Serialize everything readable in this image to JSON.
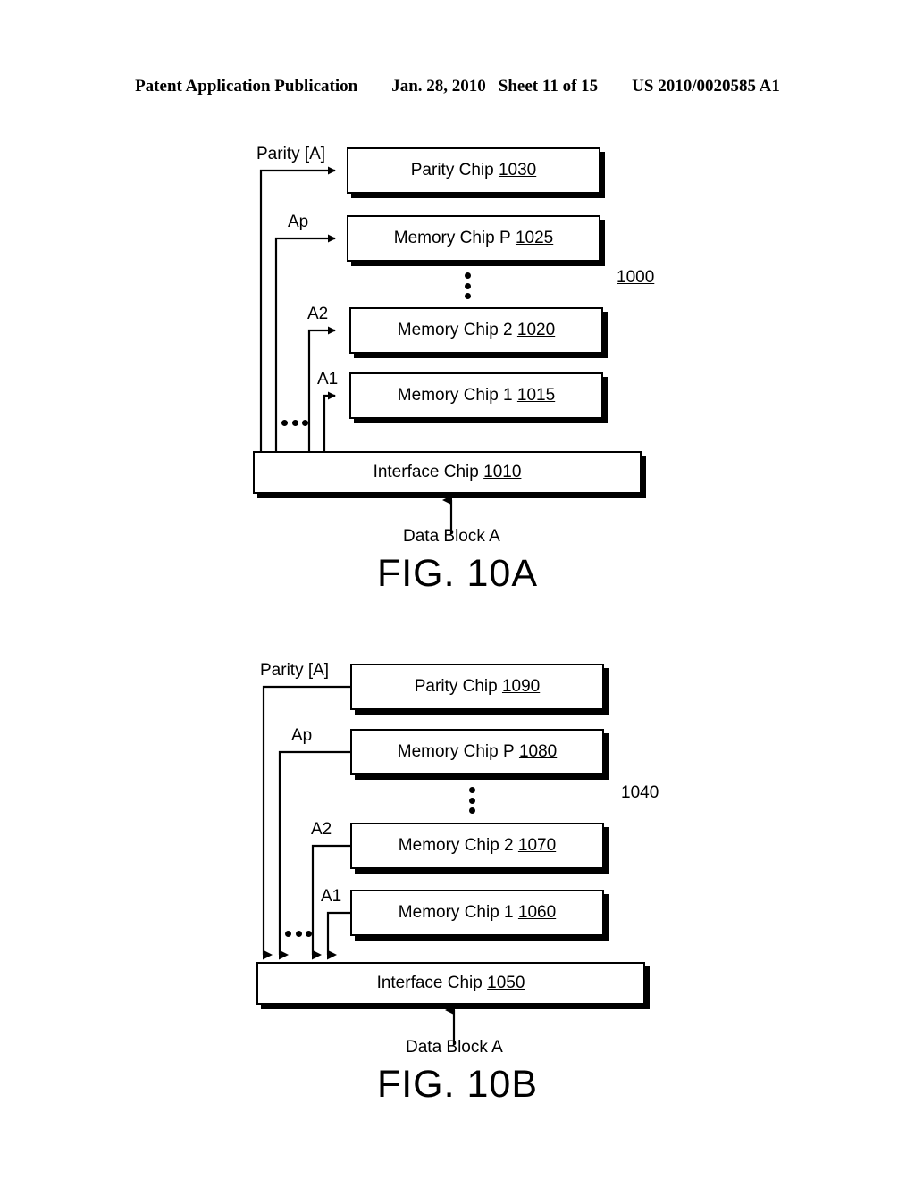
{
  "header": {
    "publication": "Patent Application Publication",
    "date": "Jan. 28, 2010",
    "sheet": "Sheet 11 of 15",
    "pub_number": "US 2010/0020585 A1"
  },
  "figures": [
    {
      "id": "fig-10a",
      "caption": "FIG. 10A",
      "assembly_ref": "1000",
      "flow": "interface-to-chips",
      "data_input_label": "Data Block A",
      "chips": [
        {
          "name": "Parity Chip",
          "ref": "1030",
          "signal": "Parity [A]"
        },
        {
          "name": "Memory Chip P",
          "ref": "1025",
          "signal": "Ap"
        },
        {
          "name": "Memory Chip 2",
          "ref": "1020",
          "signal": "A2"
        },
        {
          "name": "Memory Chip 1",
          "ref": "1015",
          "signal": "A1"
        }
      ],
      "interface_chip": {
        "name": "Interface Chip",
        "ref": "1010"
      }
    },
    {
      "id": "fig-10b",
      "caption": "FIG. 10B",
      "assembly_ref": "1040",
      "flow": "chips-to-interface",
      "data_input_label": "Data Block A",
      "chips": [
        {
          "name": "Parity Chip",
          "ref": "1090",
          "signal": "Parity [A]"
        },
        {
          "name": "Memory Chip P",
          "ref": "1080",
          "signal": "Ap"
        },
        {
          "name": "Memory Chip 2",
          "ref": "1070",
          "signal": "A2"
        },
        {
          "name": "Memory Chip 1",
          "ref": "1060",
          "signal": "A1"
        }
      ],
      "interface_chip": {
        "name": "Interface Chip",
        "ref": "1050"
      }
    }
  ],
  "colors": {
    "ink": "#000000",
    "paper": "#ffffff"
  }
}
